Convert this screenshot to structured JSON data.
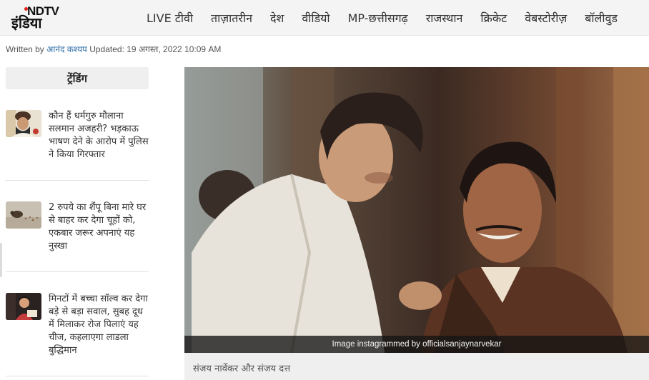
{
  "header": {
    "logo": {
      "top": "NDTV",
      "bottom": "इंडिया"
    },
    "nav": [
      "LIVE टीवी",
      "ताज़ातरीन",
      "देश",
      "वीडियो",
      "MP-छत्तीसगढ़",
      "राजस्थान",
      "क्रिकेट",
      "वेबस्टोरीज़",
      "बॉलीवुड"
    ]
  },
  "byline": {
    "written_by": "Written by",
    "author": "आनंद कश्यप",
    "updated": "Updated: 19 अगस्त, 2022 10:09 AM"
  },
  "trending": {
    "heading": "ट्रेंडिंग",
    "items": [
      {
        "title": "कौन हैं धर्मगुरु मौलाना सलमान अजहरी? भड़काऊ भाषण देने के आरोप में पुलिस ने किया गिरफ्तार",
        "thumb_icon": "cleric-thumbnail"
      },
      {
        "title": "2 रुपये का शैंपू बिना मारे घर से बाहर कर देगा चूहों को, एकबार जरूर अपनाएं यह नुस्खा",
        "thumb_icon": "rat-thumbnail"
      },
      {
        "title": "मिनटों में बच्चा सॉल्व कर देगा बड़े से बड़ा सवाल, सुबह दूध में मिलाकर रोज पिलाएं यह चीज, कहलाएगा लाडला बुद्धिमान",
        "thumb_icon": "child-thumbnail"
      }
    ]
  },
  "article_image": {
    "credit": "Image instagrammed by officialsanjaynarvekar",
    "caption": "संजय नार्वेकर और संजय दत्त"
  }
}
